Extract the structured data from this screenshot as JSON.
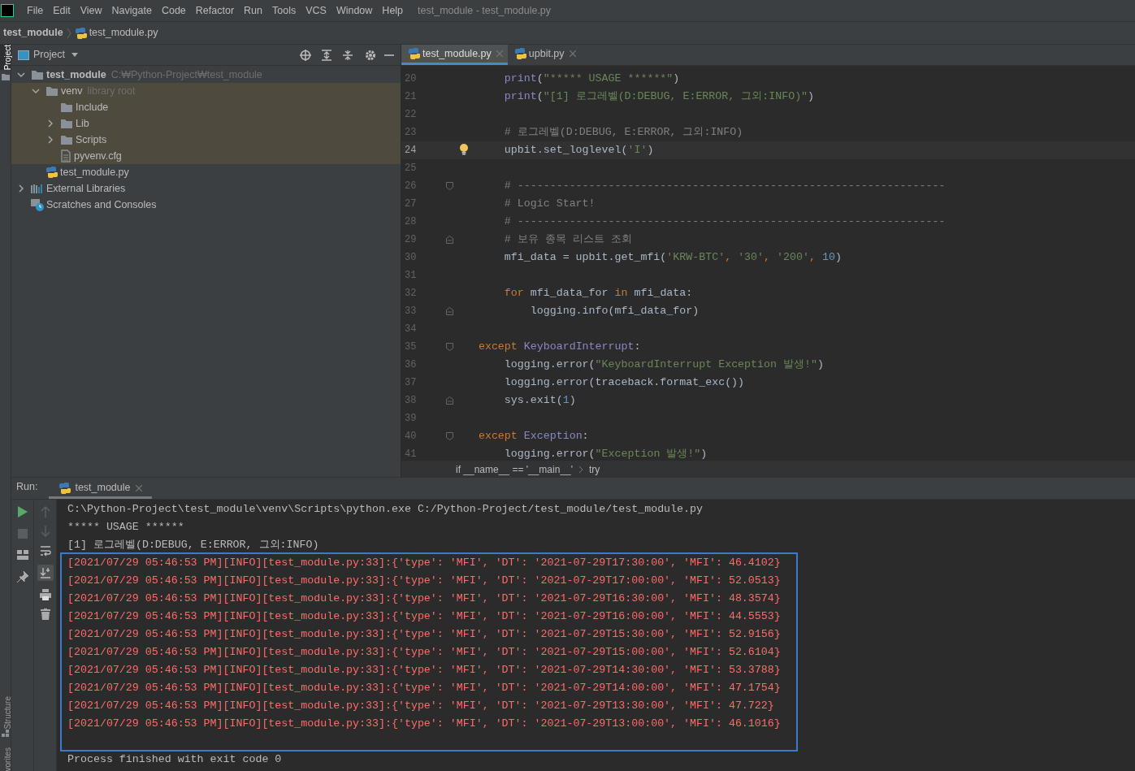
{
  "menu_bar": {
    "items": [
      "File",
      "Edit",
      "View",
      "Navigate",
      "Code",
      "Refactor",
      "Run",
      "Tools",
      "VCS",
      "Window",
      "Help"
    ],
    "title": "test_module - test_module.py"
  },
  "navigation_bar": {
    "project": "test_module",
    "file": "test_module.py"
  },
  "side_strip": {
    "top": [
      {
        "label": "Project",
        "selected": true
      }
    ],
    "bottom": [
      {
        "label": "Structure",
        "selected": false
      },
      {
        "label": "vorites",
        "selected": false
      }
    ]
  },
  "project_panel": {
    "title": "Project",
    "tree": [
      {
        "kind": "project",
        "label": "test_module",
        "hint": "C:₩Python-Project₩test_module",
        "expanded": true,
        "highlighted": false,
        "children": [
          {
            "kind": "folder",
            "label": "venv",
            "hint": "library root",
            "expanded": true,
            "highlighted": true,
            "children": [
              {
                "kind": "folder",
                "label": "Include",
                "highlighted": true
              },
              {
                "kind": "folder",
                "label": "Lib",
                "expanded": false,
                "highlighted": true
              },
              {
                "kind": "folder",
                "label": "Scripts",
                "expanded": false,
                "highlighted": true
              },
              {
                "kind": "file",
                "label": "pyvenv.cfg",
                "highlighted": true
              }
            ]
          },
          {
            "kind": "python",
            "label": "test_module.py",
            "highlighted": false
          }
        ]
      },
      {
        "kind": "libraries",
        "label": "External Libraries",
        "expanded": false,
        "highlighted": false
      },
      {
        "kind": "scratches",
        "label": "Scratches and Consoles",
        "highlighted": false
      }
    ]
  },
  "editor": {
    "tabs": [
      {
        "label": "test_module.py",
        "selected": true
      },
      {
        "label": "upbit.py",
        "selected": false
      }
    ],
    "lines": [
      {
        "number": "20",
        "current": false,
        "tokens": [
          {
            "kind": "fn",
            "text": "        print"
          },
          {
            "kind": "txt",
            "text": "("
          },
          {
            "kind": "str",
            "text": "\"***** USAGE ******\""
          },
          {
            "kind": "txt",
            "text": ")"
          }
        ]
      },
      {
        "number": "21",
        "current": false,
        "tokens": [
          {
            "kind": "fn",
            "text": "        print"
          },
          {
            "kind": "txt",
            "text": "("
          },
          {
            "kind": "str",
            "text": "\"[1] 로그레벨(D:DEBUG, E:ERROR, 그외:INFO)\""
          },
          {
            "kind": "txt",
            "text": ")"
          }
        ]
      },
      {
        "number": "22",
        "current": false
      },
      {
        "number": "23",
        "current": false,
        "tokens": [
          {
            "kind": "cmt",
            "text": "        # 로그레벨(D:DEBUG, E:ERROR, 그외:INFO)"
          }
        ]
      },
      {
        "number": "24",
        "current": true,
        "bulb": true,
        "tokens": [
          {
            "kind": "txt",
            "text": "        upbit.set_loglevel("
          },
          {
            "kind": "str",
            "text": "'I'"
          },
          {
            "kind": "txt",
            "text": ")"
          }
        ]
      },
      {
        "number": "25",
        "current": false
      },
      {
        "number": "26",
        "current": false,
        "fold_start": true,
        "tokens": [
          {
            "kind": "cmt",
            "text": "        # ------------------------------------------------------------------"
          }
        ]
      },
      {
        "number": "27",
        "current": false,
        "tokens": [
          {
            "kind": "cmt",
            "text": "        # Logic Start!"
          }
        ]
      },
      {
        "number": "28",
        "current": false,
        "tokens": [
          {
            "kind": "cmt",
            "text": "        # ------------------------------------------------------------------"
          }
        ]
      },
      {
        "number": "29",
        "current": false,
        "fold_end": true,
        "tokens": [
          {
            "kind": "cmt",
            "text": "        # 보유 종목 리스트 조회"
          }
        ]
      },
      {
        "number": "30",
        "current": false,
        "tokens": [
          {
            "kind": "txt",
            "text": "        mfi_data = upbit.get_mfi("
          },
          {
            "kind": "str",
            "text": "'KRW-BTC'"
          },
          {
            "kind": "kw",
            "text": ", "
          },
          {
            "kind": "str",
            "text": "'30'"
          },
          {
            "kind": "kw",
            "text": ", "
          },
          {
            "kind": "str",
            "text": "'200'"
          },
          {
            "kind": "kw",
            "text": ", "
          },
          {
            "kind": "num",
            "text": "10"
          },
          {
            "kind": "txt",
            "text": ")"
          }
        ]
      },
      {
        "number": "31",
        "current": false
      },
      {
        "number": "32",
        "current": false,
        "tokens": [
          {
            "kind": "kw",
            "text": "        for"
          },
          {
            "kind": "txt",
            "text": " mfi_data_for "
          },
          {
            "kind": "kw",
            "text": "in"
          },
          {
            "kind": "txt",
            "text": " mfi_data:"
          }
        ]
      },
      {
        "number": "33",
        "current": false,
        "fold_end": true,
        "tokens": [
          {
            "kind": "txt",
            "text": "            logging.info(mfi_data_for)"
          }
        ]
      },
      {
        "number": "34",
        "current": false
      },
      {
        "number": "35",
        "current": false,
        "fold_start": true,
        "tokens": [
          {
            "kind": "kw",
            "text": "    except"
          },
          {
            "kind": "cls",
            "text": " KeyboardInterrupt"
          },
          {
            "kind": "txt",
            "text": ":"
          }
        ]
      },
      {
        "number": "36",
        "current": false,
        "tokens": [
          {
            "kind": "txt",
            "text": "        logging.error("
          },
          {
            "kind": "str",
            "text": "\"KeyboardInterrupt Exception 발생!\""
          },
          {
            "kind": "txt",
            "text": ")"
          }
        ]
      },
      {
        "number": "37",
        "current": false,
        "tokens": [
          {
            "kind": "txt",
            "text": "        logging.error(traceback.format_exc())"
          }
        ]
      },
      {
        "number": "38",
        "current": false,
        "fold_end": true,
        "tokens": [
          {
            "kind": "txt",
            "text": "        sys.exit("
          },
          {
            "kind": "num",
            "text": "1"
          },
          {
            "kind": "txt",
            "text": ")"
          }
        ]
      },
      {
        "number": "39",
        "current": false
      },
      {
        "number": "40",
        "current": false,
        "fold_start": true,
        "tokens": [
          {
            "kind": "kw",
            "text": "    except"
          },
          {
            "kind": "cls",
            "text": " Exception"
          },
          {
            "kind": "txt",
            "text": ":"
          }
        ]
      },
      {
        "number": "41",
        "current": false,
        "tokens": [
          {
            "kind": "txt",
            "text": "        logging.error("
          },
          {
            "kind": "str",
            "text": "\"Exception 발생!\""
          },
          {
            "kind": "txt",
            "text": ")"
          }
        ]
      }
    ],
    "breadcrumbs": [
      "if __name__ == '__main__'",
      "try"
    ]
  },
  "run_panel": {
    "label": "Run:",
    "tab": "test_module",
    "console": [
      {
        "kind": "plain",
        "text": "C:\\Python-Project\\test_module\\venv\\Scripts\\python.exe C:/Python-Project/test_module/test_module.py"
      },
      {
        "kind": "plain",
        "text": "***** USAGE ******"
      },
      {
        "kind": "plain",
        "text": "[1] 로그레벨(D:DEBUG, E:ERROR, 그외:INFO)"
      },
      {
        "kind": "log",
        "text": "[2021/07/29 05:46:53 PM][INFO][test_module.py:33]:{'type': 'MFI', 'DT': '2021-07-29T17:30:00', 'MFI': 46.4102}"
      },
      {
        "kind": "log",
        "text": "[2021/07/29 05:46:53 PM][INFO][test_module.py:33]:{'type': 'MFI', 'DT': '2021-07-29T17:00:00', 'MFI': 52.0513}"
      },
      {
        "kind": "log",
        "text": "[2021/07/29 05:46:53 PM][INFO][test_module.py:33]:{'type': 'MFI', 'DT': '2021-07-29T16:30:00', 'MFI': 48.3574}"
      },
      {
        "kind": "log",
        "text": "[2021/07/29 05:46:53 PM][INFO][test_module.py:33]:{'type': 'MFI', 'DT': '2021-07-29T16:00:00', 'MFI': 44.5553}"
      },
      {
        "kind": "log",
        "text": "[2021/07/29 05:46:53 PM][INFO][test_module.py:33]:{'type': 'MFI', 'DT': '2021-07-29T15:30:00', 'MFI': 52.9156}"
      },
      {
        "kind": "log",
        "text": "[2021/07/29 05:46:53 PM][INFO][test_module.py:33]:{'type': 'MFI', 'DT': '2021-07-29T15:00:00', 'MFI': 52.6104}"
      },
      {
        "kind": "log",
        "text": "[2021/07/29 05:46:53 PM][INFO][test_module.py:33]:{'type': 'MFI', 'DT': '2021-07-29T14:30:00', 'MFI': 53.3788}"
      },
      {
        "kind": "log",
        "text": "[2021/07/29 05:46:53 PM][INFO][test_module.py:33]:{'type': 'MFI', 'DT': '2021-07-29T14:00:00', 'MFI': 47.1754}"
      },
      {
        "kind": "log",
        "text": "[2021/07/29 05:46:53 PM][INFO][test_module.py:33]:{'type': 'MFI', 'DT': '2021-07-29T13:30:00', 'MFI': 47.722}"
      },
      {
        "kind": "log",
        "text": "[2021/07/29 05:46:53 PM][INFO][test_module.py:33]:{'type': 'MFI', 'DT': '2021-07-29T13:00:00', 'MFI': 46.1016}"
      },
      {
        "kind": "plain",
        "text": "Process finished with exit code 0"
      }
    ]
  }
}
